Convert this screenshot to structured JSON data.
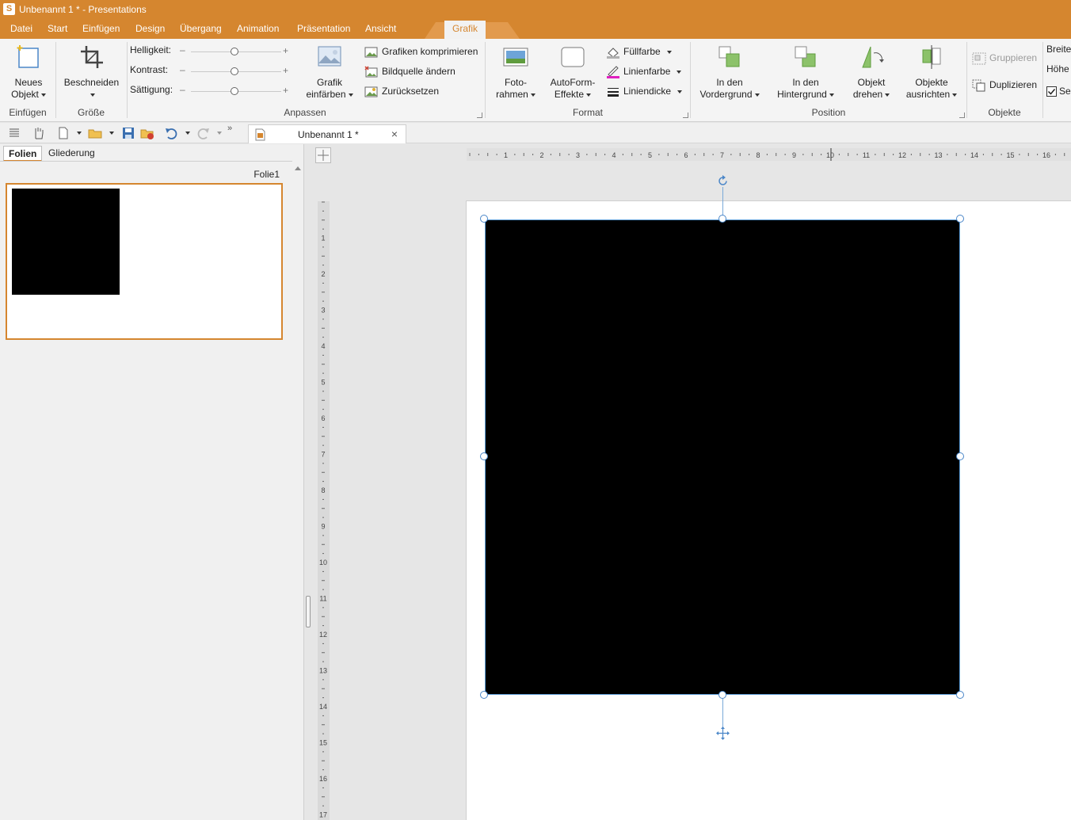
{
  "window": {
    "title": "Unbenannt 1 * - Presentations",
    "app_icon_letter": "S"
  },
  "menu": {
    "tabs": [
      "Datei",
      "Start",
      "Einfügen",
      "Design",
      "Übergang",
      "Animation",
      "Präsentation",
      "Ansicht"
    ],
    "active_tab": "Grafik"
  },
  "ribbon": {
    "einfuegen": {
      "new_object_l1": "Neues",
      "new_object_l2": "Objekt",
      "group": "Einfügen"
    },
    "groesse": {
      "crop": "Beschneiden",
      "group": "Größe"
    },
    "anpassen": {
      "brightness": "Helligkeit:",
      "contrast": "Kontrast:",
      "saturation": "Sättigung:",
      "minus": "–",
      "plus": "+",
      "recolor_l1": "Grafik",
      "recolor_l2": "einfärben",
      "compress": "Grafiken komprimieren",
      "change_source": "Bildquelle ändern",
      "reset": "Zurücksetzen",
      "group": "Anpassen"
    },
    "format": {
      "photo_frame_l1": "Foto-",
      "photo_frame_l2": "rahmen",
      "autoform_l1": "AutoForm-",
      "autoform_l2": "Effekte",
      "fill_color": "Füllfarbe",
      "line_color": "Linienfarbe",
      "line_width": "Liniendicke",
      "group": "Format"
    },
    "position": {
      "front_l1": "In den",
      "front_l2": "Vordergrund",
      "back_l1": "In den",
      "back_l2": "Hintergrund",
      "rotate_l1": "Objekt",
      "rotate_l2": "drehen",
      "align_l1": "Objekte",
      "align_l2": "ausrichten",
      "group": "Position"
    },
    "objekte": {
      "group_btn": "Gruppieren",
      "duplicate": "Duplizieren",
      "group": "Objekte"
    },
    "size_fields": {
      "width": "Breite",
      "height": "Höhe",
      "checkbox_label": "Se"
    }
  },
  "document_tab": {
    "label": "Unbenannt 1 *"
  },
  "left_panel": {
    "tabs": [
      "Folien",
      "Gliederung"
    ],
    "active": "Folien",
    "slide_caption": "Folie1"
  },
  "rulers": {
    "horizontal": [
      "1",
      "2",
      "3",
      "4",
      "5",
      "6",
      "7",
      "8",
      "9",
      "10",
      "11",
      "12",
      "13",
      "14",
      "15",
      "16"
    ],
    "vertical": [
      "1",
      "2",
      "3",
      "4",
      "5",
      "6",
      "7",
      "8",
      "9",
      "10",
      "11",
      "12",
      "13",
      "14",
      "15",
      "16",
      "17"
    ]
  },
  "colors": {
    "accent": "#d5862f",
    "selection": "#4a86c8",
    "shape_fill": "#000000"
  }
}
